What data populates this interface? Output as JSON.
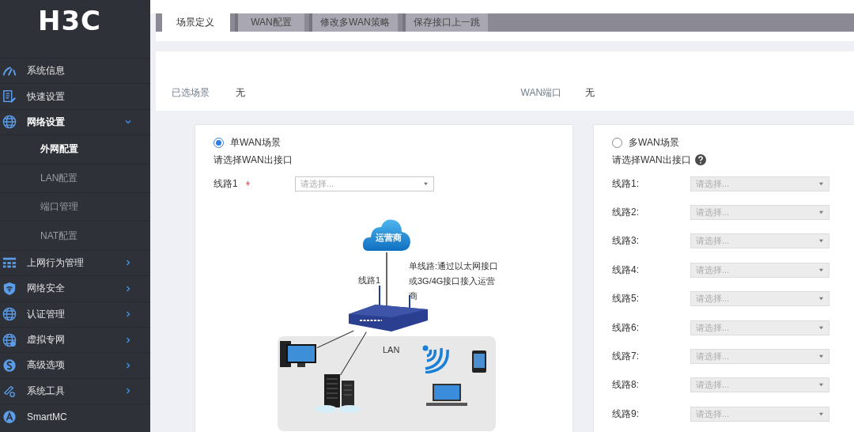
{
  "logo": "H3C",
  "sidebar": {
    "items": [
      {
        "label": "系统信息"
      },
      {
        "label": "快速设置"
      },
      {
        "label": "网络设置",
        "expanded": true,
        "children": [
          {
            "label": "外网配置",
            "selected": true
          },
          {
            "label": "LAN配置",
            "selected": false
          },
          {
            "label": "端口管理",
            "selected": false
          },
          {
            "label": "NAT配置",
            "selected": false
          }
        ]
      },
      {
        "label": "上网行为管理",
        "expanded": false
      },
      {
        "label": "网络安全",
        "expanded": false
      },
      {
        "label": "认证管理",
        "expanded": false
      },
      {
        "label": "虚拟专网",
        "expanded": false
      },
      {
        "label": "高级选项",
        "expanded": false
      },
      {
        "label": "系统工具",
        "expanded": false
      },
      {
        "label": "SmartMC"
      }
    ]
  },
  "tabs": [
    {
      "label": "场景定义",
      "selected": true
    },
    {
      "label": "WAN配置",
      "selected": false
    },
    {
      "label": "修改多WAN策略",
      "selected": false
    },
    {
      "label": "保存接口上一跳",
      "selected": false
    }
  ],
  "summary": [
    {
      "label": "已选场景",
      "value": "无"
    },
    {
      "label": "WAN端口",
      "value": "无"
    }
  ],
  "scenarios": [
    {
      "title": "单WAN场景",
      "selected": true,
      "prompt": "请选择WAN出接口",
      "lines": [
        {
          "label": "线路1",
          "required_mark": "*",
          "placeholder": "请选择...",
          "disabled": false
        }
      ],
      "diagram": {
        "cloud_label": "运营商",
        "line_label": "线路1",
        "note": "单线路:通过以太网接口或3G/4G接口接入运营商",
        "lan_label": "LAN"
      }
    },
    {
      "title": "多WAN场景",
      "selected": false,
      "prompt": "请选择WAN出接口",
      "help": true,
      "lines": [
        {
          "label": "线路1:",
          "placeholder": "请选择...",
          "disabled": true
        },
        {
          "label": "线路2:",
          "placeholder": "请选择...",
          "disabled": true
        },
        {
          "label": "线路3:",
          "placeholder": "请选择...",
          "disabled": true
        },
        {
          "label": "线路4:",
          "placeholder": "请选择...",
          "disabled": true
        },
        {
          "label": "线路5:",
          "placeholder": "请选择...",
          "disabled": true
        },
        {
          "label": "线路6:",
          "placeholder": "请选择...",
          "disabled": true
        },
        {
          "label": "线路7:",
          "placeholder": "请选择...",
          "disabled": true
        },
        {
          "label": "线路8:",
          "placeholder": "请选择...",
          "disabled": true
        },
        {
          "label": "线路9:",
          "placeholder": "请选择...",
          "disabled": true
        }
      ]
    }
  ]
}
